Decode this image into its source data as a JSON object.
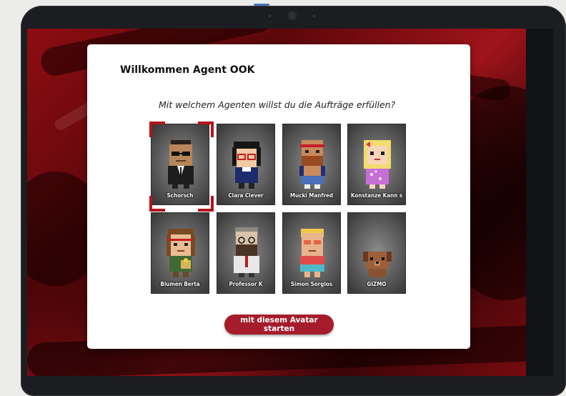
{
  "modal": {
    "title": "Willkommen Agent OOK",
    "question": "Mit welchem Agenten willst du die Aufträge erfüllen?",
    "start_button": "mit diesem Avatar starten"
  },
  "avatars": [
    {
      "name": "Schorsch",
      "selected": true
    },
    {
      "name": "Clara Clever",
      "selected": false
    },
    {
      "name": "Mucki Manfred",
      "selected": false
    },
    {
      "name": "Konstanze Kann s",
      "selected": false
    },
    {
      "name": "Blumen Berta",
      "selected": false
    },
    {
      "name": "Professor K",
      "selected": false
    },
    {
      "name": "Simon Sorglos",
      "selected": false
    },
    {
      "name": "GIZMO",
      "selected": false
    }
  ],
  "colors": {
    "accent": "#a51c2c",
    "selection": "#b3141c",
    "background_red": "#8d0d12"
  }
}
